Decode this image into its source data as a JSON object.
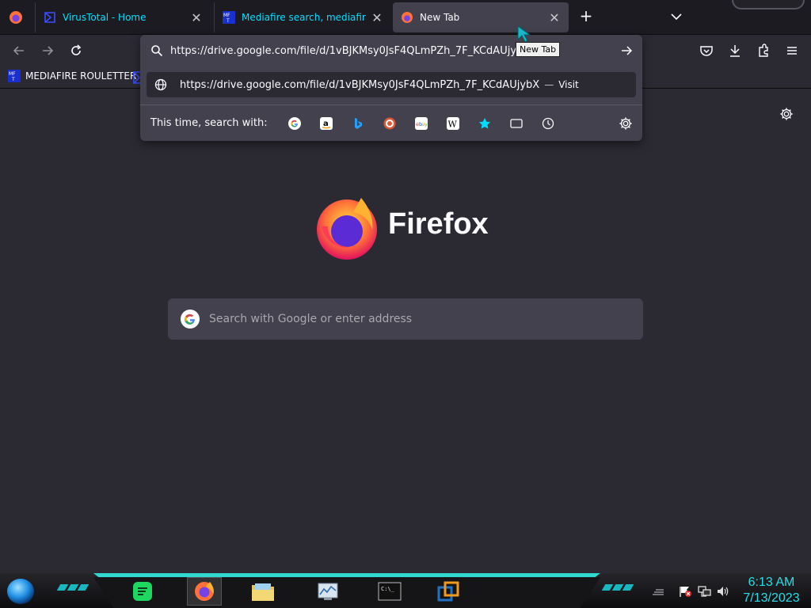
{
  "tabs": [
    {
      "title": "VirusTotal - Home",
      "icon": "virustotal-icon"
    },
    {
      "title": "Mediafire search, mediafire search",
      "icon": "mft-icon"
    },
    {
      "title": "New Tab",
      "icon": "firefox-icon",
      "active": true
    }
  ],
  "bookmarks": [
    {
      "label": "MEDIAFIRE ROULETTER",
      "icon": "mft-icon"
    }
  ],
  "urlbar": {
    "value": "https://drive.google.com/file/d/1vBJKMsy0JsF4QLmPZh_7F_KCdAUjybX",
    "result_url": "https://drive.google.com/file/d/1vBJKMsy0JsF4QLmPZh_7F_KCdAUjybX",
    "result_sep": "—",
    "result_action": "Visit",
    "oneoff_label": "This time, search with:",
    "engines": [
      "google-icon",
      "amazon-icon",
      "bing-icon",
      "duckduckgo-icon",
      "ebay-icon",
      "wikipedia-icon",
      "bookmarks-icon",
      "tabs-icon",
      "history-icon"
    ]
  },
  "tooltip": "New Tab",
  "newtab": {
    "wordmark": "Firefox",
    "search_placeholder": "Search with Google or enter address"
  },
  "taskbar": {
    "time": "6:13 AM",
    "date": "7/13/2023",
    "apps": [
      "spotify-icon",
      "firefox-icon",
      "file-explorer-icon",
      "task-manager-icon",
      "command-prompt-icon",
      "virtualbox-icon"
    ],
    "accent": "#20e0e8"
  }
}
